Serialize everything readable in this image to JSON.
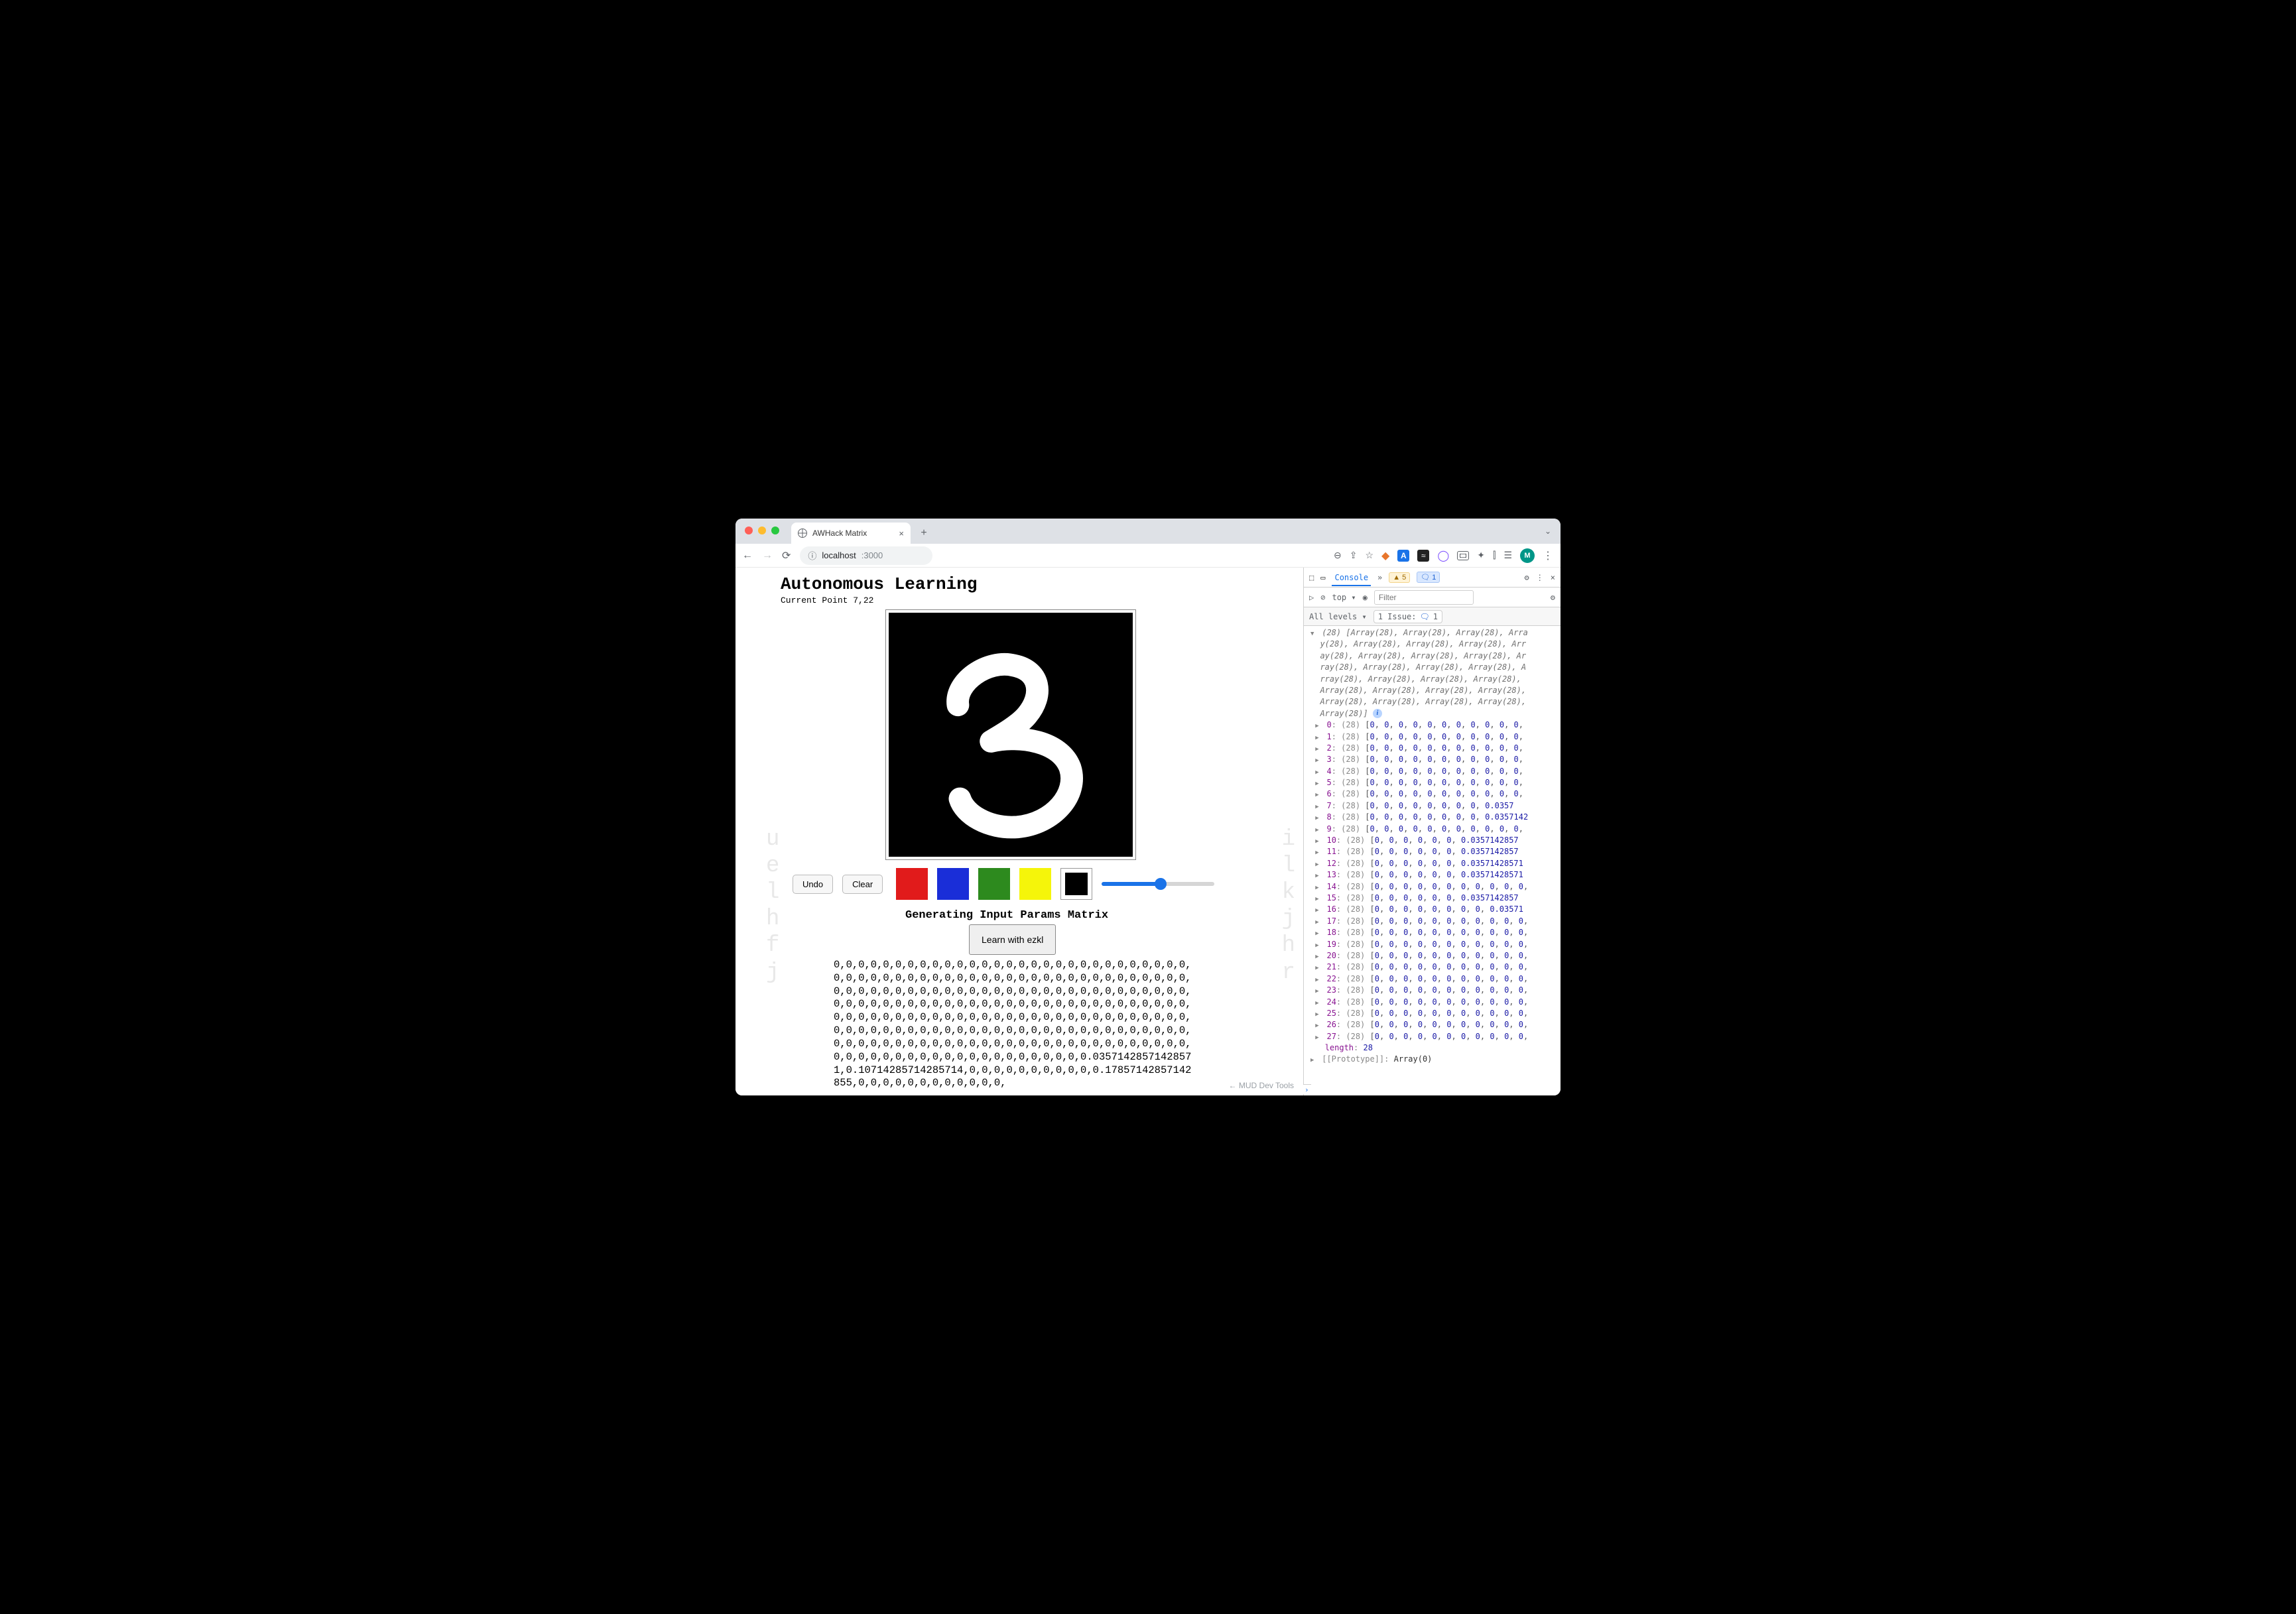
{
  "browser": {
    "tab_title": "AWHack Matrix",
    "url_host": "localhost",
    "url_port": ":3000",
    "avatar_initial": "M"
  },
  "page": {
    "heading": "Autonomous Learning",
    "current_point_label": "Current Point 7,22",
    "undo_label": "Undo",
    "clear_label": "Clear",
    "colors": {
      "red": "#e11b1b",
      "blue": "#1a2ed8",
      "green": "#2d8a1e",
      "yellow": "#f5f50a",
      "black": "#000000"
    },
    "slider_percent": 52,
    "gen_title": "Generating Input Params Matrix",
    "ezkl_label": "Learn with ezkl",
    "matrix_text": "0,0,0,0,0,0,0,0,0,0,0,0,0,0,0,0,0,0,0,0,0,0,0,0,0,0,0,0,0,0,0,0,0,0,0,0,0,0,0,0,0,0,0,0,0,0,0,0,0,0,0,0,0,0,0,0,0,0,0,0,0,0,0,0,0,0,0,0,0,0,0,0,0,0,0,0,0,0,0,0,0,0,0,0,0,0,0,0,0,0,0,0,0,0,0,0,0,0,0,0,0,0,0,0,0,0,0,0,0,0,0,0,0,0,0,0,0,0,0,0,0,0,0,0,0,0,0,0,0,0,0,0,0,0,0,0,0,0,0,0,0,0,0,0,0,0,0,0,0,0,0,0,0,0,0,0,0,0,0,0,0,0,0,0,0,0,0,0,0,0,0,0,0,0,0,0,0,0,0,0,0,0,0,0,0,0,0,0,0,0,0,0,0,0,0,0,0,0,0,0,0,0,0,0,0,0,0,0,0,0,0,0,0,0,0,0,0,0,0,0,0,0,0,0.03571428571428571,0.10714285714285714,0,0,0,0,0,0,0,0,0,0,0.17857142857142855,0,0,0,0,0,0,0,0,0,0,0,0,",
    "mud_link": "← MUD Dev Tools"
  },
  "ghost_left": "u\ne\nl\nh\nf\nj",
  "ghost_right": "i\nl\nk\nj\nh\nr",
  "devtools": {
    "tab_console": "Console",
    "warn_count": "5",
    "info_count": "1",
    "ctx_label": "top",
    "filter_placeholder": "Filter",
    "levels_label": "All levels",
    "issue_label": "1 Issue:",
    "issue_count": "1",
    "header_italic_lines": [
      "(28) [Array(28), Array(28), Array(28), Arra",
      "y(28), Array(28), Array(28), Array(28), Arr",
      "ay(28), Array(28), Array(28), Array(28), Ar",
      "ray(28), Array(28), Array(28), Array(28), A",
      "rray(28), Array(28), Array(28), Array(28),",
      "Array(28), Array(28), Array(28), Array(28),",
      "Array(28), Array(28), Array(28), Array(28),",
      "Array(28)]"
    ],
    "length_label": "length",
    "length_value": "28",
    "proto_label": "[[Prototype]]",
    "proto_value": "Array(0)",
    "rows": [
      {
        "i": "0",
        "tail": "[0, 0, 0, 0, 0, 0, 0, 0, 0, 0, 0,"
      },
      {
        "i": "1",
        "tail": "[0, 0, 0, 0, 0, 0, 0, 0, 0, 0, 0,"
      },
      {
        "i": "2",
        "tail": "[0, 0, 0, 0, 0, 0, 0, 0, 0, 0, 0,"
      },
      {
        "i": "3",
        "tail": "[0, 0, 0, 0, 0, 0, 0, 0, 0, 0, 0,"
      },
      {
        "i": "4",
        "tail": "[0, 0, 0, 0, 0, 0, 0, 0, 0, 0, 0,"
      },
      {
        "i": "5",
        "tail": "[0, 0, 0, 0, 0, 0, 0, 0, 0, 0, 0,"
      },
      {
        "i": "6",
        "tail": "[0, 0, 0, 0, 0, 0, 0, 0, 0, 0, 0,"
      },
      {
        "i": "7",
        "tail": "[0, 0, 0, 0, 0, 0, 0, 0, 0.0357"
      },
      {
        "i": "8",
        "tail": "[0, 0, 0, 0, 0, 0, 0, 0, 0.0357142"
      },
      {
        "i": "9",
        "tail": "[0, 0, 0, 0, 0, 0, 0, 0, 0, 0, 0,"
      },
      {
        "i": "10",
        "tail": "[0, 0, 0, 0, 0, 0, 0.0357142857"
      },
      {
        "i": "11",
        "tail": "[0, 0, 0, 0, 0, 0, 0.0357142857"
      },
      {
        "i": "12",
        "tail": "[0, 0, 0, 0, 0, 0, 0.03571428571"
      },
      {
        "i": "13",
        "tail": "[0, 0, 0, 0, 0, 0, 0.03571428571"
      },
      {
        "i": "14",
        "tail": "[0, 0, 0, 0, 0, 0, 0, 0, 0, 0, 0,"
      },
      {
        "i": "15",
        "tail": "[0, 0, 0, 0, 0, 0, 0.0357142857"
      },
      {
        "i": "16",
        "tail": "[0, 0, 0, 0, 0, 0, 0, 0, 0.03571"
      },
      {
        "i": "17",
        "tail": "[0, 0, 0, 0, 0, 0, 0, 0, 0, 0, 0,"
      },
      {
        "i": "18",
        "tail": "[0, 0, 0, 0, 0, 0, 0, 0, 0, 0, 0,"
      },
      {
        "i": "19",
        "tail": "[0, 0, 0, 0, 0, 0, 0, 0, 0, 0, 0,"
      },
      {
        "i": "20",
        "tail": "[0, 0, 0, 0, 0, 0, 0, 0, 0, 0, 0,"
      },
      {
        "i": "21",
        "tail": "[0, 0, 0, 0, 0, 0, 0, 0, 0, 0, 0,"
      },
      {
        "i": "22",
        "tail": "[0, 0, 0, 0, 0, 0, 0, 0, 0, 0, 0,"
      },
      {
        "i": "23",
        "tail": "[0, 0, 0, 0, 0, 0, 0, 0, 0, 0, 0,"
      },
      {
        "i": "24",
        "tail": "[0, 0, 0, 0, 0, 0, 0, 0, 0, 0, 0,"
      },
      {
        "i": "25",
        "tail": "[0, 0, 0, 0, 0, 0, 0, 0, 0, 0, 0,"
      },
      {
        "i": "26",
        "tail": "[0, 0, 0, 0, 0, 0, 0, 0, 0, 0, 0,"
      },
      {
        "i": "27",
        "tail": "[0, 0, 0, 0, 0, 0, 0, 0, 0, 0, 0,"
      }
    ]
  }
}
